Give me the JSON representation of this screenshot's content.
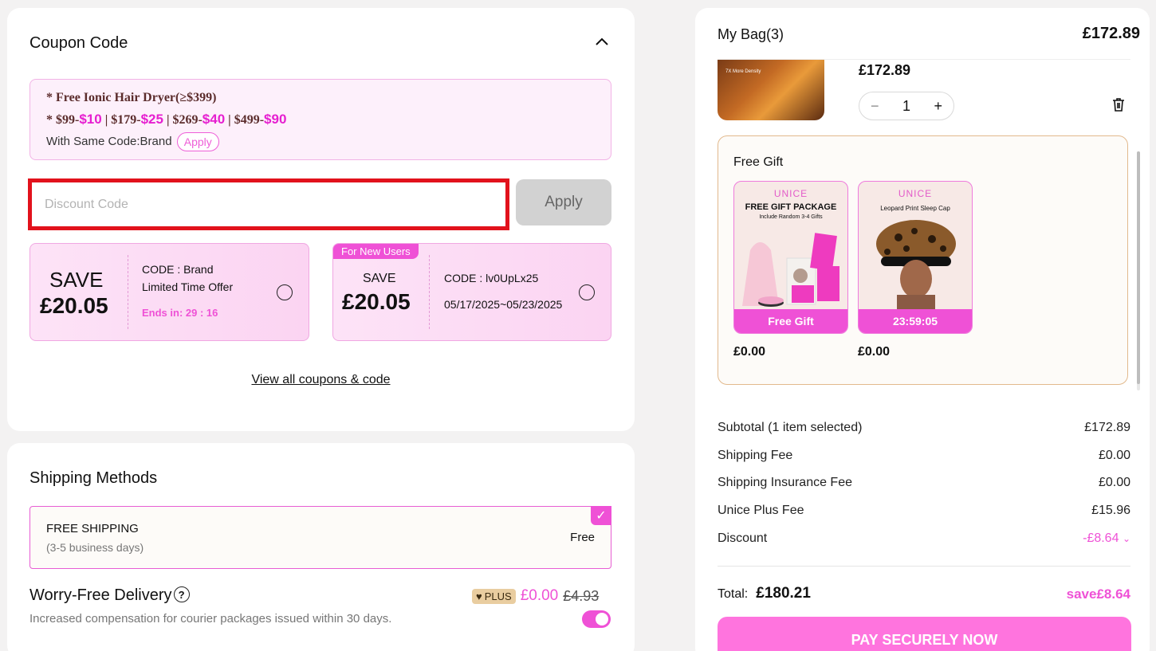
{
  "coupon": {
    "title": "Coupon Code",
    "promo": {
      "line1": "* Free Ionic Hair Dryer(≥$399)",
      "line2_parts": [
        {
          "text": "* $99-",
          "pink": false
        },
        {
          "text": "$10",
          "pink": true
        },
        {
          "text": " | $179-",
          "pink": false
        },
        {
          "text": "$25",
          "pink": true
        },
        {
          "text": " | $269-",
          "pink": false
        },
        {
          "text": "$40",
          "pink": true
        },
        {
          "text": " | $499-",
          "pink": false
        },
        {
          "text": "$90",
          "pink": true
        }
      ],
      "line3": "With Same Code:Brand",
      "apply_label": "Apply"
    },
    "input_placeholder": "Discount Code",
    "apply_label": "Apply",
    "coupons": [
      {
        "save_label": "SAVE",
        "amount": "£20.05",
        "code": "CODE : Brand",
        "note": "Limited Time Offer",
        "ends": "Ends in: 29 : 16"
      },
      {
        "tag": "For New Users",
        "save_label": "SAVE",
        "amount": "£20.05",
        "code": "CODE : lv0UpLx25",
        "dates": "05/17/2025~05/23/2025"
      }
    ],
    "view_all": "View all coupons & code"
  },
  "shipping": {
    "title": "Shipping Methods",
    "method_name": "FREE SHIPPING",
    "method_days": "(3-5 business days)",
    "method_price": "Free",
    "worry_title": "Worry-Free Delivery",
    "worry_desc": "Increased compensation for courier packages issued within 30 days.",
    "plus_label": "PLUS",
    "plus_price": "£0.00",
    "old_price": "£4.93",
    "toggle_on": true
  },
  "bag": {
    "title": "My Bag(3)",
    "total_top": "£172.89",
    "product_price": "£172.89",
    "product_thumb_caption": "7X More Density",
    "qty": "1",
    "gift_title": "Free Gift",
    "gifts": [
      {
        "brand": "UNICE",
        "name": "FREE GIFT PACKAGE",
        "sub": "Include Random 3-4 Gifts",
        "bar": "Free Gift",
        "price": "£0.00"
      },
      {
        "brand": "UNICE",
        "name": "Leopard Print Sleep Cap",
        "bar": "23:59:05",
        "price": "£0.00"
      }
    ],
    "summary": [
      {
        "label": "Subtotal (1 item selected)",
        "value": "£172.89"
      },
      {
        "label": "Shipping Fee",
        "value": "£0.00"
      },
      {
        "label": "Shipping Insurance Fee",
        "value": "£0.00"
      },
      {
        "label": "Unice Plus Fee",
        "value": "£15.96"
      },
      {
        "label": "Discount",
        "value": "-£8.64"
      }
    ],
    "total_label": "Total:",
    "total_value": "£180.21",
    "save_text": "save£8.64",
    "pay_label": "PAY SECURELY NOW"
  },
  "colors": {
    "accent": "#ef51d6",
    "highlight_border": "#e2121c"
  }
}
